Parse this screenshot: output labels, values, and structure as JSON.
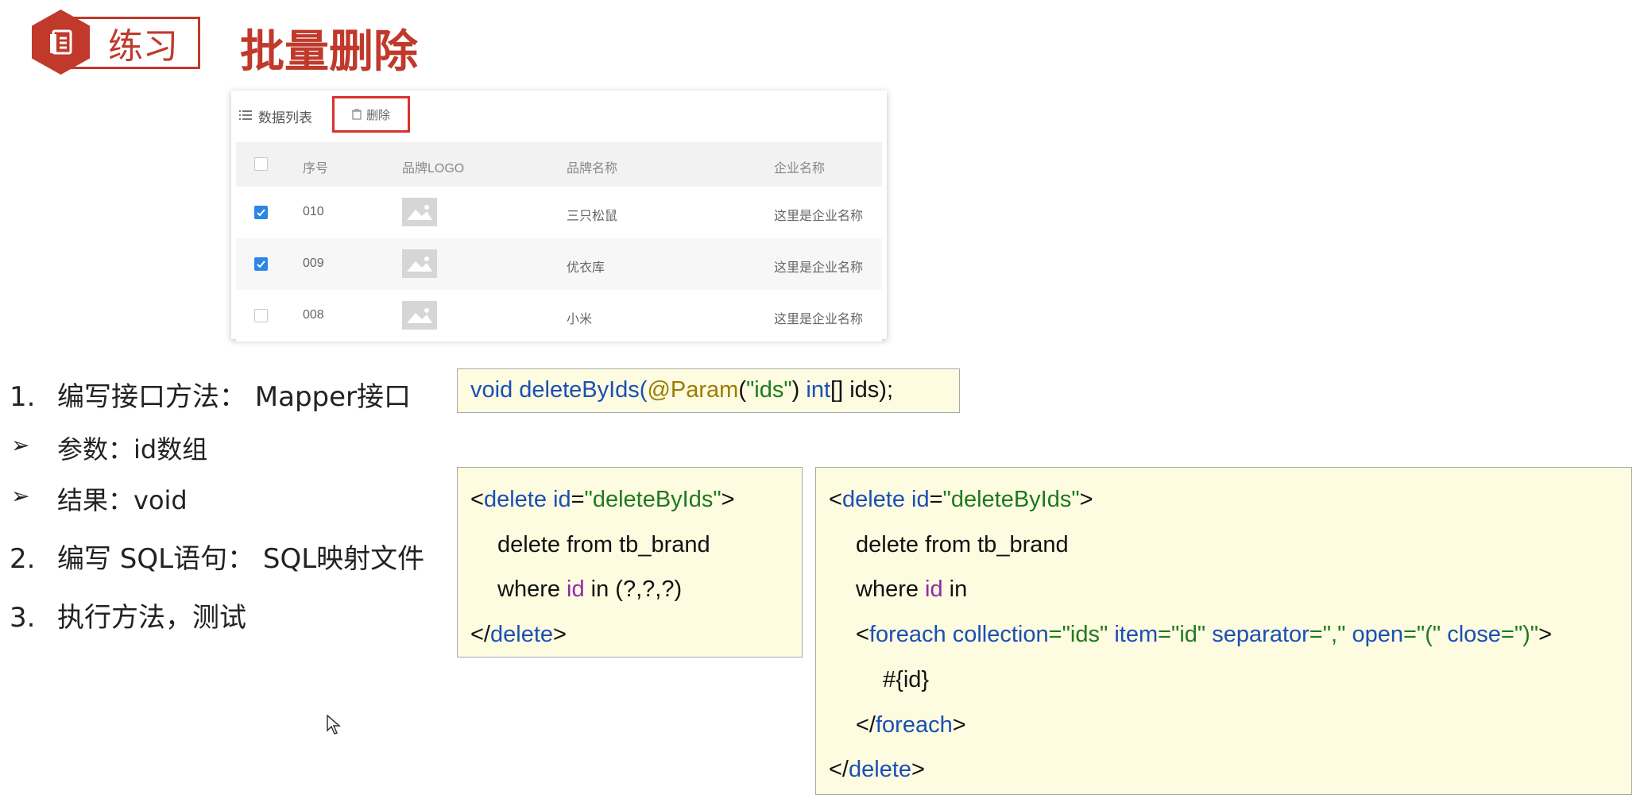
{
  "header": {
    "badge_icon": "document-icon",
    "label": "练习",
    "title": "批量删除"
  },
  "table_panel": {
    "toolbar_title": "数据列表",
    "delete_button": "删除",
    "columns": [
      "序号",
      "品牌LOGO",
      "品牌名称",
      "企业名称"
    ],
    "rows": [
      {
        "checked": true,
        "id": "010",
        "brand": "三只松鼠",
        "company": "这里是企业名称"
      },
      {
        "checked": true,
        "id": "009",
        "brand": "优衣库",
        "company": "这里是企业名称"
      },
      {
        "checked": false,
        "id": "008",
        "brand": "小米",
        "company": "这里是企业名称"
      }
    ]
  },
  "steps": {
    "s1_num": "1.",
    "s1_text": "编写接口方法： Mapper接口",
    "b1": "参数：id数组",
    "b2": "结果：void",
    "s2_num": "2.",
    "s2_text": "编写 SQL语句： SQL映射文件",
    "s3_num": "3.",
    "s3_text": "执行方法，测试"
  },
  "code_interface": {
    "void": "void",
    "method": "deleteByIds(",
    "anno": "@Param",
    "paren_open": "(",
    "str": "\"ids\"",
    "paren_close": ")",
    "int": "int",
    "rest": "[] ids);"
  },
  "code_simple": {
    "l1_lt": "<",
    "l1_tag": "delete",
    "l1_attr": "id",
    "l1_eq": "=",
    "l1_val": "\"deleteByIds\"",
    "l1_gt": ">",
    "l2": "delete from tb_brand",
    "l3_where": "where ",
    "l3_id": "id",
    "l3_rest": " in (?,?,?)",
    "l4_lt": "</",
    "l4_tag": "delete",
    "l4_gt": ">"
  },
  "code_foreach": {
    "l1_lt": "<",
    "l1_tag": "delete",
    "l1_attr": "id",
    "l1_eq": "=",
    "l1_val": "\"deleteByIds\"",
    "l1_gt": ">",
    "l2": "delete from tb_brand",
    "l3_where": "where ",
    "l3_id": "id",
    "l3_rest": " in",
    "l4_lt": "<",
    "l4_tag": "foreach",
    "l4_a1": "collection",
    "l4_v1": "=\"ids\"",
    "l4_a2": "item",
    "l4_v2": "=\"id\"",
    "l4_a3": "separator",
    "l4_v3": "=\",\"",
    "l4_a4": "open",
    "l4_v4": "=\"(\"",
    "l4_a5": "close",
    "l4_v5": "=\")\"",
    "l4_gt": ">",
    "l5": "#{id}",
    "l6_lt": "</",
    "l6_tag": "foreach",
    "l6_gt": ">",
    "l7_lt": "</",
    "l7_tag": "delete",
    "l7_gt": ">"
  },
  "colors": {
    "accent_red": "#c0392b",
    "keyword_blue": "#1a4fb5",
    "string_green": "#1e7a1e",
    "annotation_gold": "#9a7d00",
    "id_purple": "#8e2ba8",
    "code_bg": "#fdfbe0",
    "checkbox_blue": "#2b86e6"
  },
  "cursor_icon": "mouse-pointer-icon"
}
